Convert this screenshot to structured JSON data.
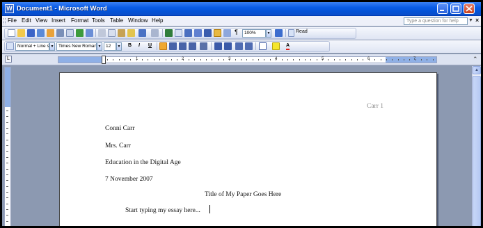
{
  "window": {
    "title": "Document1 - Microsoft Word",
    "app_icon": "W",
    "controls": [
      "minimize-icon",
      "maximize-icon",
      "close-icon"
    ],
    "title_bar_color": "#0a5ce6"
  },
  "menu": {
    "items": [
      "File",
      "Edit",
      "View",
      "Insert",
      "Format",
      "Tools",
      "Table",
      "Window",
      "Help"
    ],
    "help_placeholder": "Type a question for help"
  },
  "standard_toolbar": {
    "zoom": "100%",
    "read_label": "Read"
  },
  "formatting_toolbar": {
    "style": "Normal + Line s",
    "font": "Times New Roman",
    "size": "12",
    "bold": "B",
    "italic": "I",
    "underline": "U"
  },
  "ruler": {
    "numbers": [
      "1",
      "2",
      "3",
      "4",
      "5",
      "6",
      "7"
    ]
  },
  "document": {
    "header": "Carr   1",
    "lines": [
      "Conni Carr",
      "Mrs. Carr",
      "Education in the Digital Age",
      "7 November 2007"
    ],
    "title": "Title of My Paper Goes Here",
    "body": "Start typing my essay here..."
  }
}
